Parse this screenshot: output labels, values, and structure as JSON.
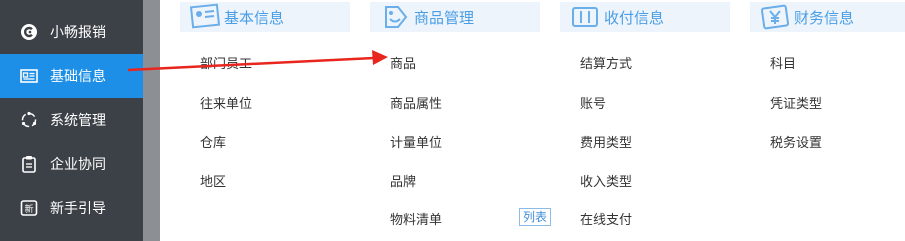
{
  "sidebar": {
    "items": [
      {
        "label": "小畅报销",
        "icon": "logo-icon",
        "active": false
      },
      {
        "label": "基础信息",
        "icon": "id-card-icon",
        "active": true
      },
      {
        "label": "系统管理",
        "icon": "cycle-icon",
        "active": false
      },
      {
        "label": "企业协同",
        "icon": "clipboard-icon",
        "active": false
      },
      {
        "label": "新手引导",
        "icon": "new-badge-icon",
        "active": false
      }
    ]
  },
  "categories": [
    {
      "title": "基本信息",
      "icon": "id-card-icon",
      "items": [
        "部门员工",
        "往来单位",
        "仓库",
        "地区"
      ]
    },
    {
      "title": "商品管理",
      "icon": "tag-icon",
      "items": [
        "商品",
        "商品属性",
        "计量单位",
        "品牌",
        "物料清单"
      ],
      "badge": "列表"
    },
    {
      "title": "收付信息",
      "icon": "wallet-icon",
      "items": [
        "结算方式",
        "账号",
        "费用类型",
        "收入类型",
        "在线支付"
      ]
    },
    {
      "title": "财务信息",
      "icon": "yen-icon",
      "items": [
        "科目",
        "凭证类型",
        "税务设置"
      ]
    }
  ],
  "colors": {
    "sidebar_bg": "#3c4148",
    "active_bg": "#1e8fe6",
    "header_bg": "#eef4fb",
    "header_text": "#4a9ee6",
    "arrow": "#e8261e"
  }
}
